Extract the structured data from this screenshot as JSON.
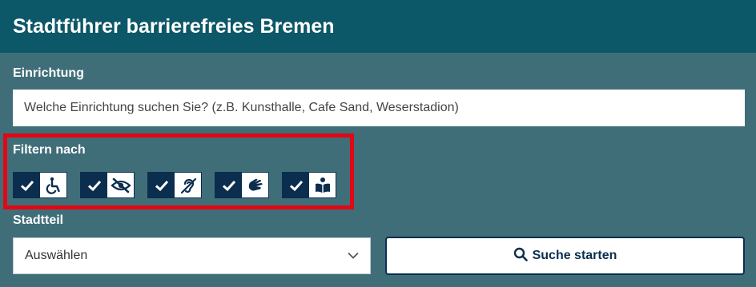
{
  "header": {
    "title": "Stadtführer barrierefreies Bremen"
  },
  "facility": {
    "label": "Einrichtung",
    "placeholder": "Welche Einrichtung suchen Sie? (z.B. Kunsthalle, Cafe Sand, Weserstadion)"
  },
  "filter": {
    "label": "Filtern nach",
    "items": [
      {
        "icon": "wheelchair-icon",
        "checked": true
      },
      {
        "icon": "eye-slash-icon",
        "checked": true
      },
      {
        "icon": "hearing-impaired-icon",
        "checked": true
      },
      {
        "icon": "sign-language-icon",
        "checked": true
      },
      {
        "icon": "book-reader-icon",
        "checked": true
      }
    ]
  },
  "district": {
    "label": "Stadtteil",
    "selected": "Auswählen"
  },
  "search_button": {
    "label": "Suche starten",
    "icon": "search-icon"
  },
  "colors": {
    "header_bg": "#0c5768",
    "body_bg": "#3f6e79",
    "filter_dark": "#0b2e4f",
    "highlight": "#e30613"
  }
}
